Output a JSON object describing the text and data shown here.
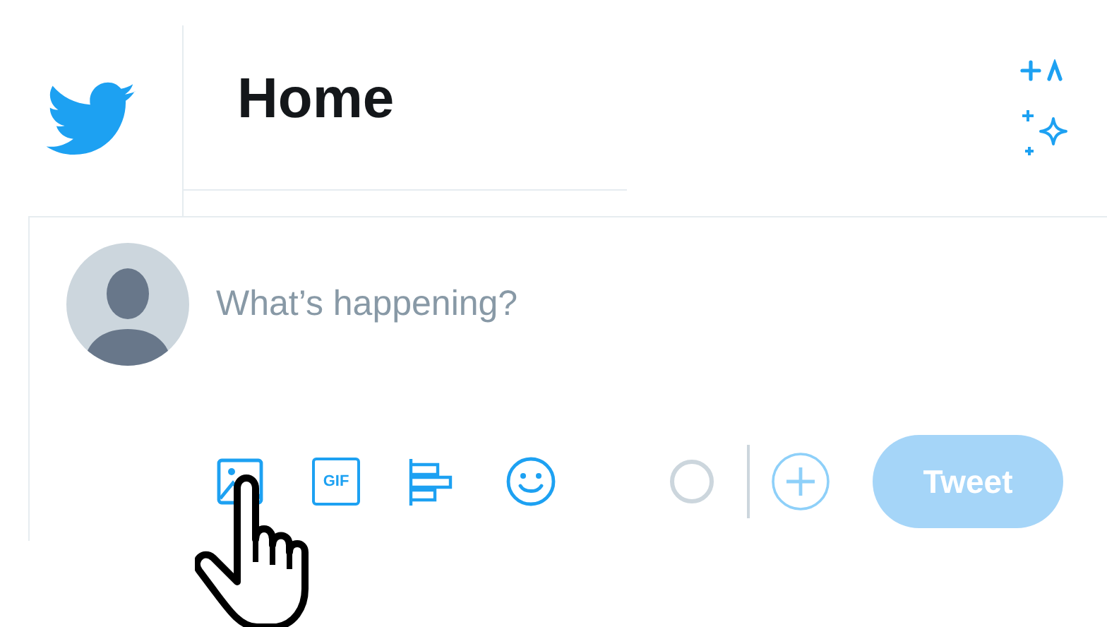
{
  "header": {
    "title": "Home"
  },
  "composer": {
    "placeholder": "What’s happening?"
  },
  "toolbar": {
    "gif_label": "GIF"
  },
  "tweet_button": {
    "label": "Tweet",
    "disabled": true
  }
}
